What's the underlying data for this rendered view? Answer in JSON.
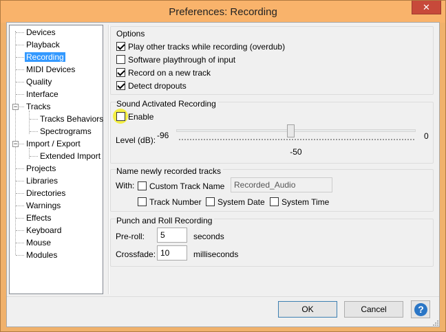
{
  "window": {
    "title": "Preferences: Recording",
    "close_glyph": "✕"
  },
  "tree": {
    "items": [
      {
        "label": "Devices"
      },
      {
        "label": "Playback"
      },
      {
        "label": "Recording",
        "selected": true
      },
      {
        "label": "MIDI Devices"
      },
      {
        "label": "Quality"
      },
      {
        "label": "Interface"
      },
      {
        "label": "Tracks",
        "expander": "−"
      },
      {
        "label": "Tracks Behaviors"
      },
      {
        "label": "Spectrograms"
      },
      {
        "label": "Import / Export",
        "expander": "−"
      },
      {
        "label": "Extended Import"
      },
      {
        "label": "Projects"
      },
      {
        "label": "Libraries"
      },
      {
        "label": "Directories"
      },
      {
        "label": "Warnings"
      },
      {
        "label": "Effects"
      },
      {
        "label": "Keyboard"
      },
      {
        "label": "Mouse"
      },
      {
        "label": "Modules"
      }
    ]
  },
  "options": {
    "title": "Options",
    "overdub": {
      "label": "Play other tracks while recording (overdub)",
      "checked": true
    },
    "software_playthrough": {
      "label": "Software playthrough of input",
      "checked": false
    },
    "record_new_track": {
      "label": "Record on a new track",
      "checked": true
    },
    "detect_dropouts": {
      "label": "Detect dropouts",
      "checked": true
    }
  },
  "sound_activated": {
    "title": "Sound Activated Recording",
    "enable": {
      "label": "Enable",
      "checked": false
    },
    "level_label": "Level (dB):",
    "min_label": "-96",
    "max_label": "0",
    "value_label": "-50",
    "level_min": -96,
    "level_max": 0,
    "level_value": -50
  },
  "naming": {
    "title": "Name newly recorded tracks",
    "with_label": "With:",
    "custom_track_name": {
      "label": "Custom Track Name",
      "checked": false
    },
    "custom_name_value": "Recorded_Audio",
    "track_number": {
      "label": "Track Number",
      "checked": false
    },
    "system_date": {
      "label": "System Date",
      "checked": false
    },
    "system_time": {
      "label": "System Time",
      "checked": false
    }
  },
  "punch_roll": {
    "title": "Punch and Roll Recording",
    "preroll_label": "Pre-roll:",
    "preroll_value": "5",
    "preroll_unit": "seconds",
    "crossfade_label": "Crossfade:",
    "crossfade_value": "10",
    "crossfade_unit": "milliseconds"
  },
  "buttons": {
    "ok": "OK",
    "cancel": "Cancel",
    "help": "?"
  },
  "colors": {
    "selection": "#3399ff",
    "highlight": "#f4ee31",
    "titlebar": "#f9b36b"
  },
  "icons": {
    "help": "help-icon",
    "close": "close-icon"
  }
}
